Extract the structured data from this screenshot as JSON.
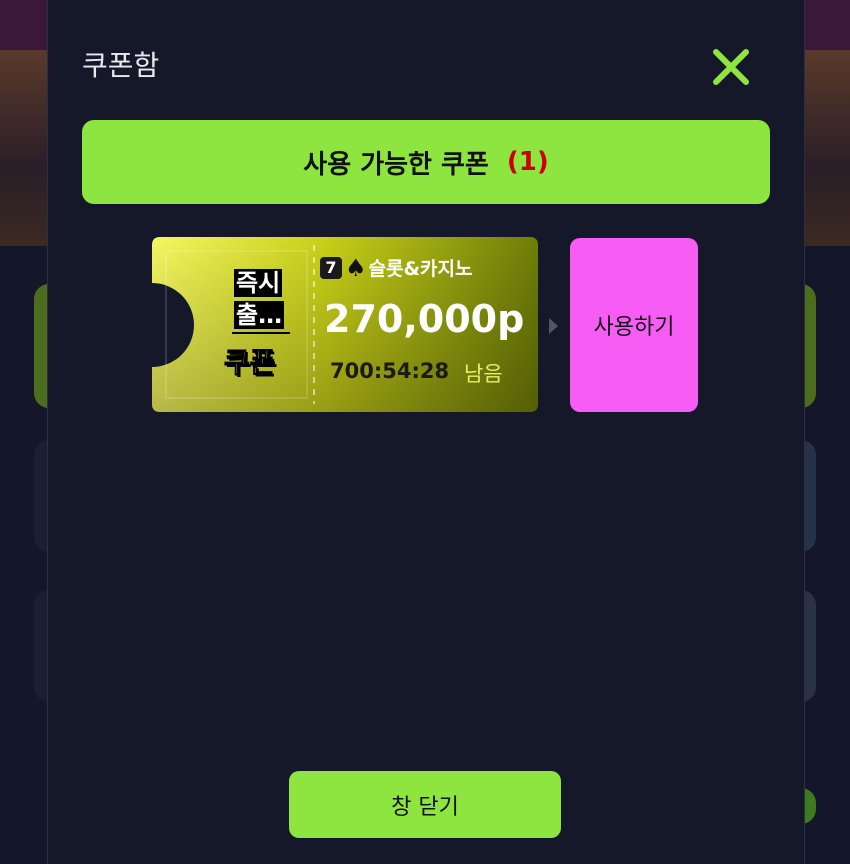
{
  "modal": {
    "title": "쿠폰함",
    "tab_label": "사용 가능한 쿠폰",
    "tab_count": "(1)",
    "close_window_label": "창 닫기"
  },
  "coupon": {
    "type_line1": "즉시",
    "type_line2": "출…",
    "label": "쿠폰",
    "badge_number": "7",
    "badge_suit": "♠",
    "game_name": "슬롯&카지노",
    "amount": "270,000p",
    "timer": "700:54:28",
    "remaining_label": "남음",
    "use_label": "사용하기"
  },
  "colors": {
    "accent_green": "#8ee53f",
    "use_button_pink": "#f75df5",
    "count_red": "#cc0000",
    "ticket_yellow": "#c9d21a"
  },
  "icons": {
    "close": "close-icon",
    "arrow": "arrow-right-icon",
    "badge": "seven-icon",
    "suit": "spade-icon"
  }
}
